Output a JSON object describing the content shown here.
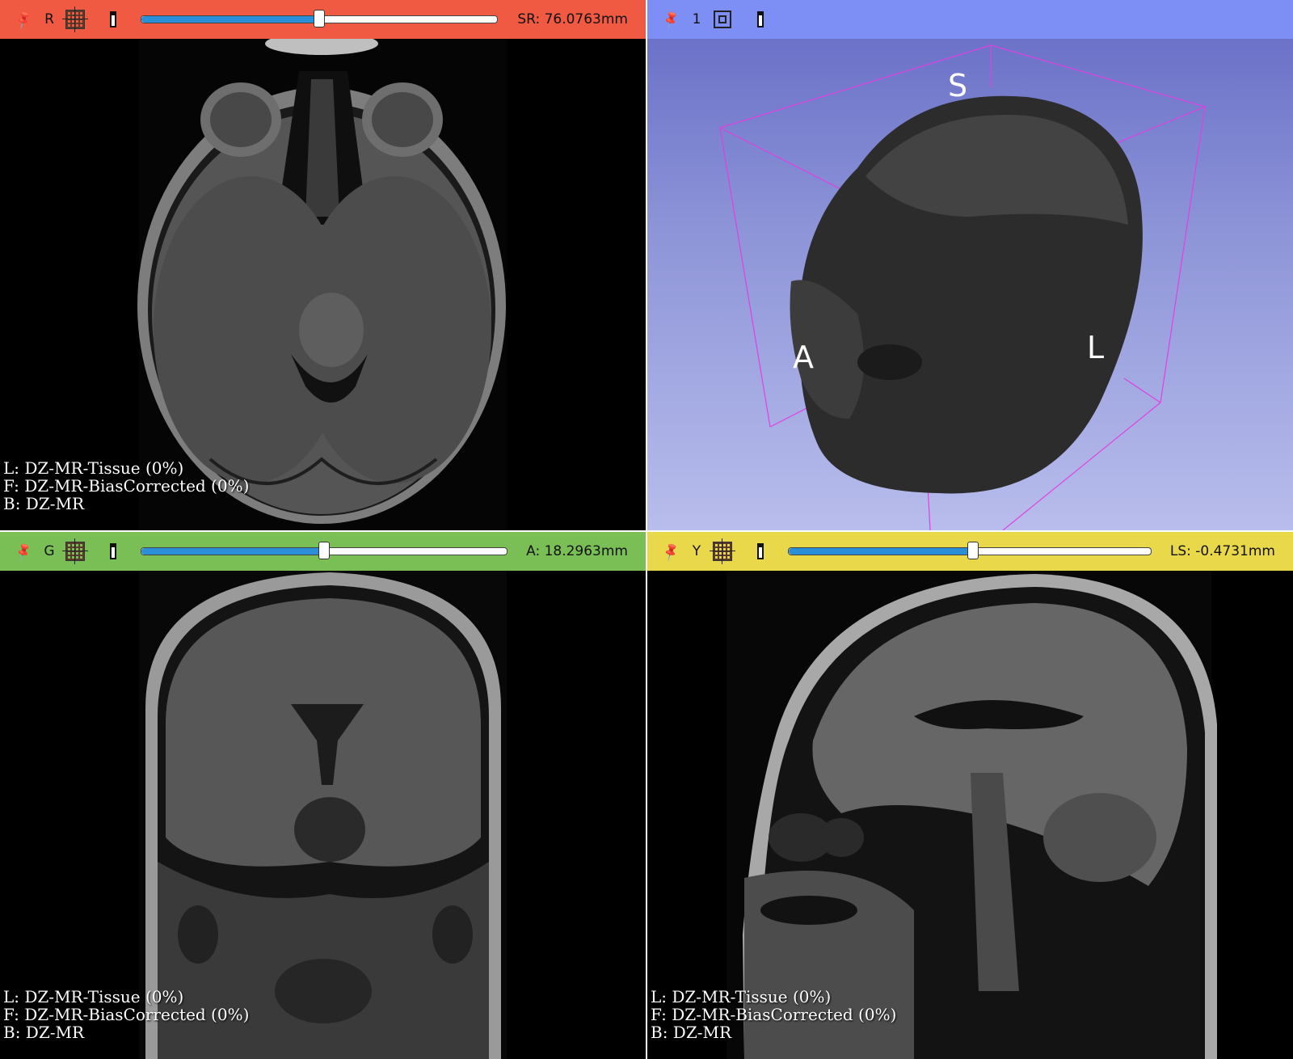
{
  "views": {
    "red": {
      "label": "R",
      "readout": "SR: 76.0763mm",
      "slider_percent": 50,
      "layers": [
        "L: DZ-MR-Tissue (0%)",
        "F: DZ-MR-BiasCorrected (0%)",
        "B: DZ-MR"
      ]
    },
    "threed": {
      "label": "1",
      "orientation": {
        "superior": "S",
        "anterior": "A",
        "left": "L"
      }
    },
    "green": {
      "label": "G",
      "readout": "A: 18.2963mm",
      "slider_percent": 50,
      "layers": [
        "L: DZ-MR-Tissue (0%)",
        "F: DZ-MR-BiasCorrected (0%)",
        "B: DZ-MR"
      ]
    },
    "yellow": {
      "label": "Y",
      "readout": "LS: -0.4731mm",
      "slider_percent": 50,
      "layers": [
        "L: DZ-MR-Tissue (0%)",
        "F: DZ-MR-BiasCorrected (0%)",
        "B: DZ-MR"
      ]
    }
  },
  "icons": {
    "pin": "pin-icon",
    "slice_grid": "slice-grid-icon",
    "maximize": "maximize-view-icon",
    "center": "center-3d-icon"
  },
  "colors": {
    "red_bar": "#f05a43",
    "blue_bar": "#7d8ef5",
    "green_bar": "#7abf55",
    "yellow_bar": "#ead84b",
    "slider_fill": "#2a8fd6"
  }
}
